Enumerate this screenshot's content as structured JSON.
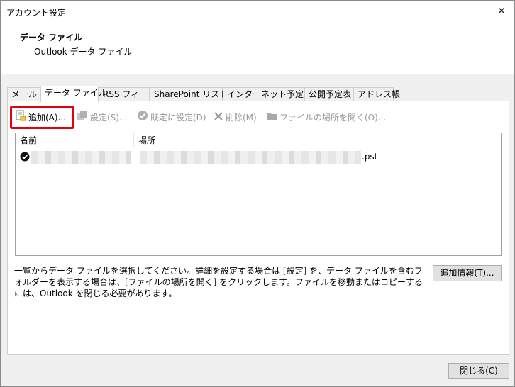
{
  "window": {
    "title": "アカウント設定",
    "close_glyph": "✕"
  },
  "header": {
    "title": "データ ファイル",
    "subtitle": "Outlook データ ファイル"
  },
  "tabs": [
    {
      "label": "メール"
    },
    {
      "label": "データ ファイル"
    },
    {
      "label": "RSS フィード"
    },
    {
      "label": "SharePoint リスト"
    },
    {
      "label": "インターネット予定表"
    },
    {
      "label": "公開予定表"
    },
    {
      "label": "アドレス帳"
    }
  ],
  "toolbar": {
    "add": "追加(A)...",
    "settings": "設定(S)...",
    "set_default": "既定に設定(D)",
    "remove": "削除(M)",
    "open_location": "ファイルの場所を開く(O)..."
  },
  "list": {
    "columns": [
      "名前",
      "場所"
    ],
    "rows": [
      {
        "location_suffix": ".pst",
        "is_default": true
      }
    ]
  },
  "description": "一覧からデータ ファイルを選択してください。詳細を設定する場合は [設定] を、データ ファイルを含むフォルダーを表示する場合は、[ファイルの場所を開く] をクリックします。ファイルを移動またはコピーするには、Outlook を閉じる必要があります。",
  "buttons": {
    "extra_info": "追加情報(T)...",
    "close": "閉じる(C)"
  },
  "colors": {
    "highlight": "#e0000e",
    "disabled_text": "#9a9a9a"
  }
}
